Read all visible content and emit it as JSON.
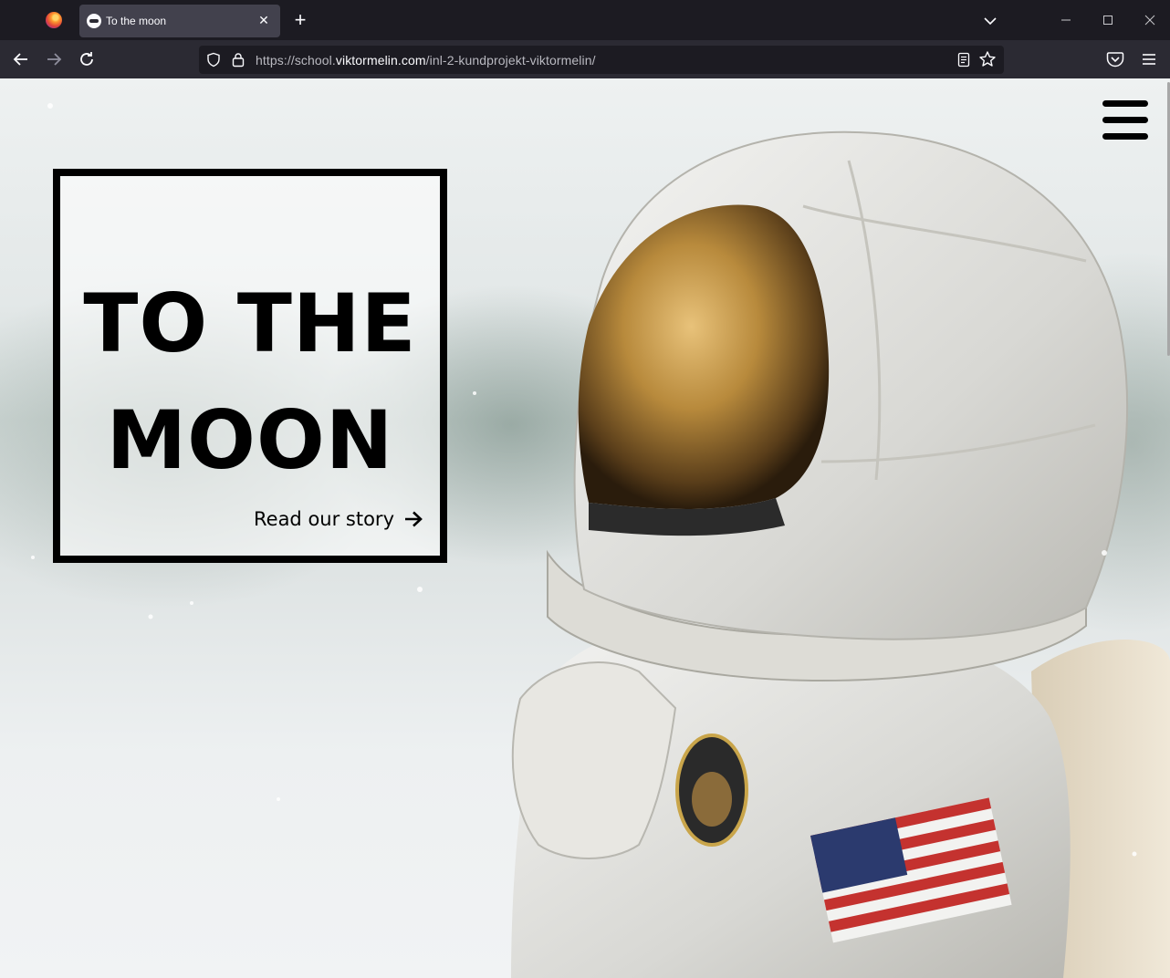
{
  "browser": {
    "tab_title": "To the moon",
    "tab_close_glyph": "✕",
    "new_tab_glyph": "+",
    "url_prefix": "https://school.",
    "url_domain": "viktormelin.com",
    "url_path": "/inl-2-kundprojekt-viktormelin/",
    "icons": [
      "firefox-logo",
      "list-all-tabs-icon",
      "back-icon",
      "forward-icon",
      "reload-icon",
      "shield-icon",
      "lock-icon",
      "reader-view-icon",
      "bookmark-star-icon",
      "pocket-icon",
      "app-menu-icon",
      "minimize-icon",
      "maximize-icon",
      "close-icon"
    ]
  },
  "page": {
    "hero": {
      "title_line1": "TO THE",
      "title_line2": "MOON",
      "link_label": "Read our story"
    },
    "menu_icon": "hamburger-icon"
  }
}
